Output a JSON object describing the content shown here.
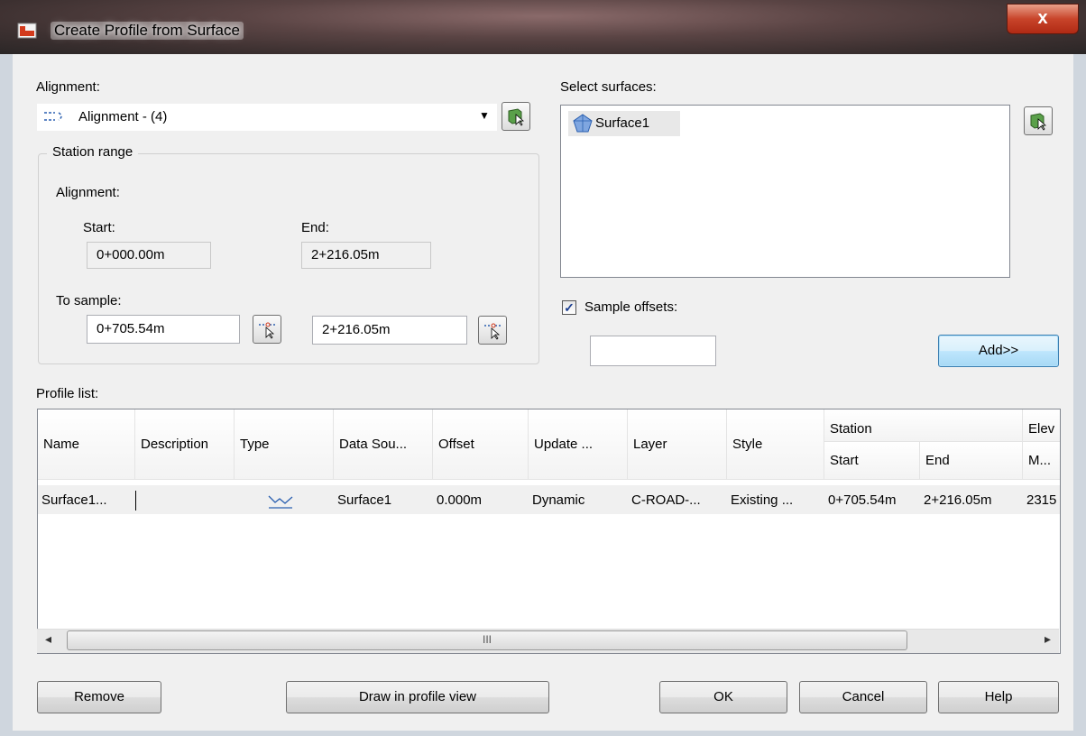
{
  "window": {
    "title": "Create Profile from Surface",
    "close_glyph": "x"
  },
  "alignment": {
    "label": "Alignment:",
    "selected": "Alignment - (4)"
  },
  "station_range": {
    "legend": "Station range",
    "alignment_label": "Alignment:",
    "start_label": "Start:",
    "end_label": "End:",
    "start_value": "0+000.00m",
    "end_value": "2+216.05m",
    "to_sample_label": "To sample:",
    "sample_start": "0+705.54m",
    "sample_end": "2+216.05m"
  },
  "surfaces": {
    "label": "Select surfaces:",
    "items": [
      "Surface1"
    ]
  },
  "sample_offsets": {
    "label": "Sample offsets:",
    "checked": true,
    "value": ""
  },
  "add_button": "Add>>",
  "profile_list": {
    "label": "Profile list:",
    "headers": [
      "Name",
      "Description",
      "Type",
      "Data Sou...",
      "Offset",
      "Update ...",
      "Layer",
      "Style"
    ],
    "station_group": "Station",
    "station_start": "Start",
    "station_end": "End",
    "elev_group": "Elev",
    "elev_sub": "M...",
    "rows": [
      {
        "name": "Surface1...",
        "description": "",
        "data_source": "Surface1",
        "offset": "0.000m",
        "update": "Dynamic",
        "layer": "C-ROAD-...",
        "style": "Existing ...",
        "start": "0+705.54m",
        "end": "2+216.05m",
        "elev": "2315"
      }
    ]
  },
  "scrollbar": {
    "thumb_grip": "III",
    "left_arrow": "◂",
    "right_arrow": "▸"
  },
  "buttons": {
    "remove": "Remove",
    "draw": "Draw in profile view",
    "ok": "OK",
    "cancel": "Cancel",
    "help": "Help"
  },
  "colors": {
    "accent": "#3c7fb1",
    "checkmark": "#1a3d8f"
  }
}
